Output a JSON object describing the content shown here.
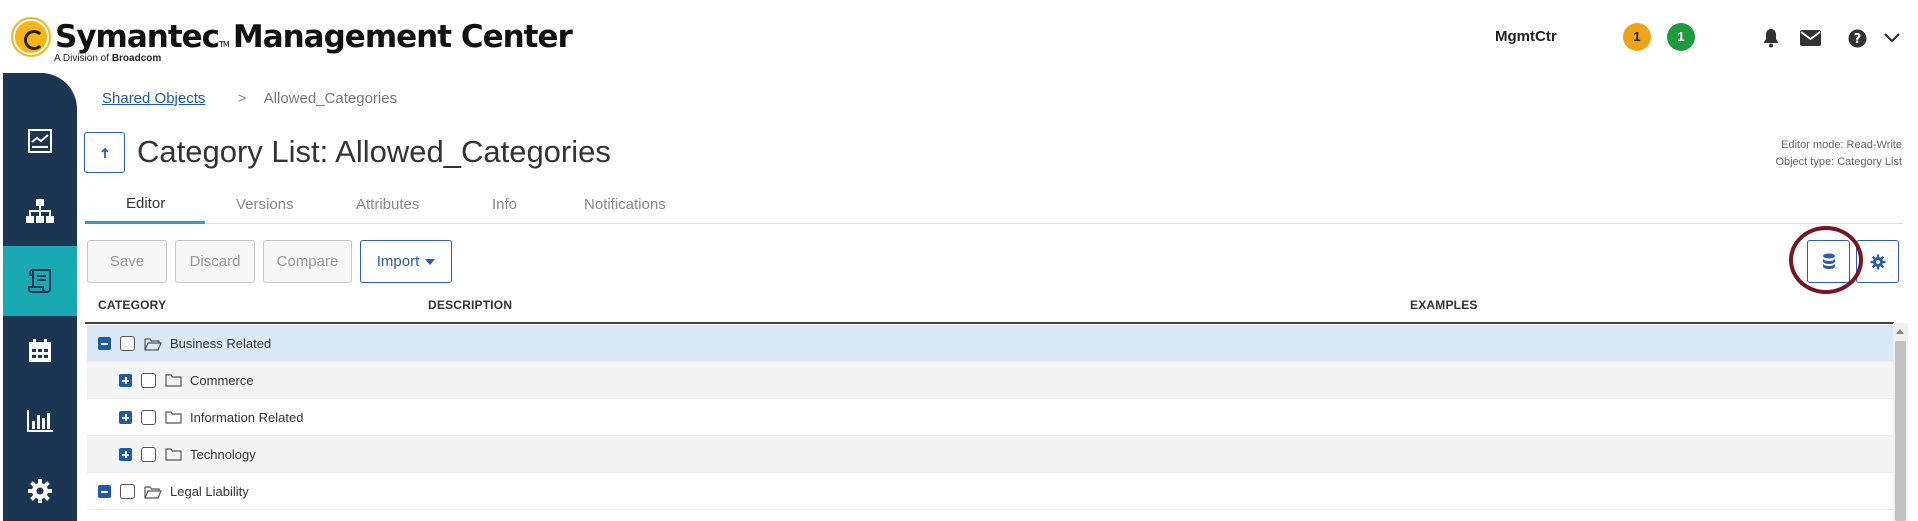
{
  "header": {
    "brand": "Symantec",
    "brand_tm": "TM",
    "product": "Management Center",
    "subbrand_prefix": "A Division of",
    "subbrand_company": "Broadcom",
    "instance": "MgmtCtr",
    "alert_count_warning": "1",
    "alert_count_ok": "1",
    "icons": [
      "bell-icon",
      "mail-icon",
      "help-icon",
      "chevron-down-icon"
    ]
  },
  "leftnav": {
    "items": [
      "dashboard-icon",
      "network-icon",
      "policy-icon",
      "calendar-icon",
      "reports-icon",
      "settings-icon"
    ],
    "active": "policy-icon"
  },
  "breadcrumb": {
    "parent": "Shared Objects",
    "separator": ">",
    "current": "Allowed_Categories"
  },
  "page": {
    "title": "Category List: Allowed_Categories",
    "editor_mode": "Editor mode: Read-Write",
    "object_type": "Object type: Category List"
  },
  "tabs": [
    "Editor",
    "Versions",
    "Attributes",
    "Info",
    "Notifications"
  ],
  "toolbar": {
    "save": "Save",
    "discard": "Discard",
    "compare": "Compare",
    "import": "Import"
  },
  "table": {
    "columns": [
      "CATEGORY",
      "DESCRIPTION",
      "EXAMPLES"
    ],
    "rows": [
      {
        "label": "Business Related",
        "expanded": true
      },
      {
        "label": "Commerce",
        "expanded": false
      },
      {
        "label": "Information Related",
        "expanded": false
      },
      {
        "label": "Technology",
        "expanded": false
      },
      {
        "label": "Legal Liability",
        "expanded": true
      }
    ]
  },
  "colors": {
    "nav_bg": "#1c3552",
    "nav_active": "#18a9b2",
    "accent": "#2b5da8",
    "highlight": "#7a1424"
  }
}
